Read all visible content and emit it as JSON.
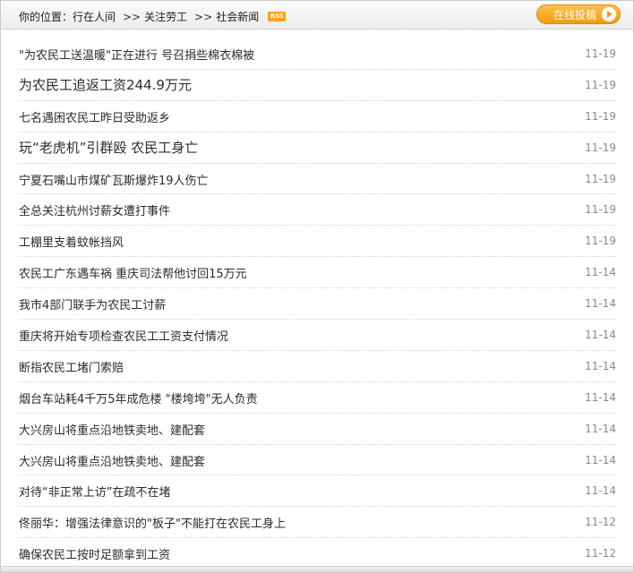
{
  "breadcrumb": {
    "prefix": "你的位置：",
    "home": "行在人间",
    "sep1": ">>",
    "level2": "关注劳工",
    "sep2": ">>",
    "level3": "社会新闻",
    "rss_label": "RSS"
  },
  "submit_button": {
    "label": "在线投稿",
    "icon": "play-circle-icon",
    "color": "#f29a0e"
  },
  "news": [
    {
      "title": "\"为农民工送温暖\"正在进行 号召捐些棉衣棉被",
      "date": "11-19",
      "large": false
    },
    {
      "title": "为农民工追返工资244.9万元",
      "date": "11-19",
      "large": true
    },
    {
      "title": "七名遇困农民工昨日受助返乡",
      "date": "11-19",
      "large": false
    },
    {
      "title": "玩“老虎机”引群殴 农民工身亡",
      "date": "11-19",
      "large": true
    },
    {
      "title": "宁夏石嘴山市煤矿瓦斯爆炸19人伤亡",
      "date": "11-19",
      "large": false
    },
    {
      "title": "全总关注杭州讨薪女遭打事件",
      "date": "11-19",
      "large": false
    },
    {
      "title": "工棚里支着蚊帐挡风",
      "date": "11-19",
      "large": false
    },
    {
      "title": "农民工广东遇车祸 重庆司法帮他讨回15万元",
      "date": "11-14",
      "large": false
    },
    {
      "title": "我市4部门联手为农民工讨薪",
      "date": "11-14",
      "large": false
    },
    {
      "title": "重庆将开始专项检查农民工工资支付情况",
      "date": "11-14",
      "large": false
    },
    {
      "title": "断指农民工堵门索赔",
      "date": "11-14",
      "large": false
    },
    {
      "title": "烟台车站耗4千万5年成危楼 \"楼垮垮\"无人负责",
      "date": "11-14",
      "large": false
    },
    {
      "title": "大兴房山将重点沿地铁卖地、建配套",
      "date": "11-14",
      "large": false
    },
    {
      "title": "大兴房山将重点沿地铁卖地、建配套",
      "date": "11-14",
      "large": false
    },
    {
      "title": "对待“非正常上访”在疏不在堵",
      "date": "11-14",
      "large": false
    },
    {
      "title": "佟丽华：增强法律意识的\"板子\"不能打在农民工身上",
      "date": "11-12",
      "large": false
    },
    {
      "title": "确保农民工按时足额拿到工资",
      "date": "11-12",
      "large": false
    }
  ]
}
